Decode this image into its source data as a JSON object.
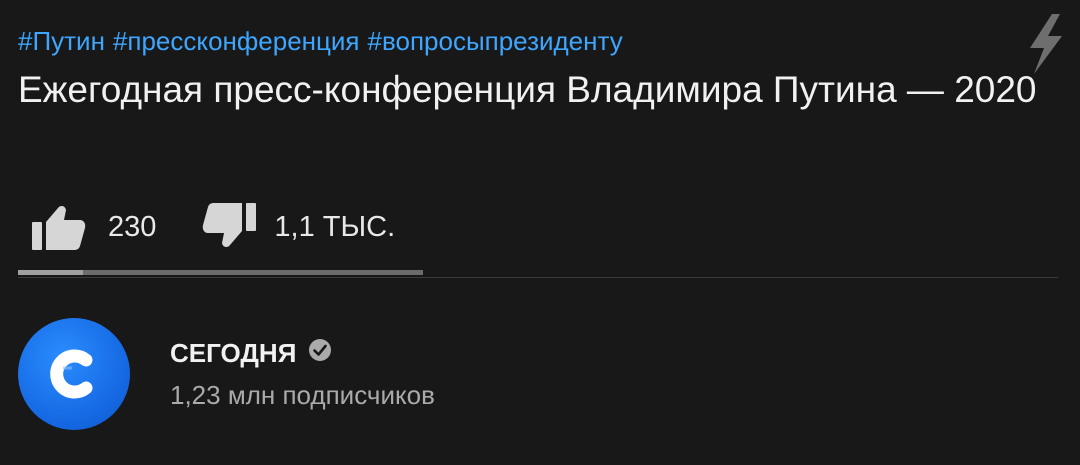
{
  "video": {
    "hashtags": [
      "#Путин",
      "#прессконференция",
      "#вопросыпрезиденту"
    ],
    "title": "Ежегодная пресс-конференция Владимира Путина — 2020"
  },
  "rating": {
    "likes": "230",
    "dislikes": "1,1 ТЫС.",
    "like_fraction": 0.16
  },
  "channel": {
    "name": "СЕГОДНЯ",
    "subscribers": "1,23 млн подписчиков",
    "verified": true,
    "avatar_color": "#1a73e8"
  },
  "icons": {
    "top_right": "flash-icon",
    "like": "thumbs-up-icon",
    "dislike": "thumbs-down-icon",
    "verified": "verified-check-icon"
  },
  "colors": {
    "background": "#181818",
    "hashtag": "#3ea6ff",
    "text": "#f1f1f1",
    "secondary_text": "#aaaaaa"
  }
}
